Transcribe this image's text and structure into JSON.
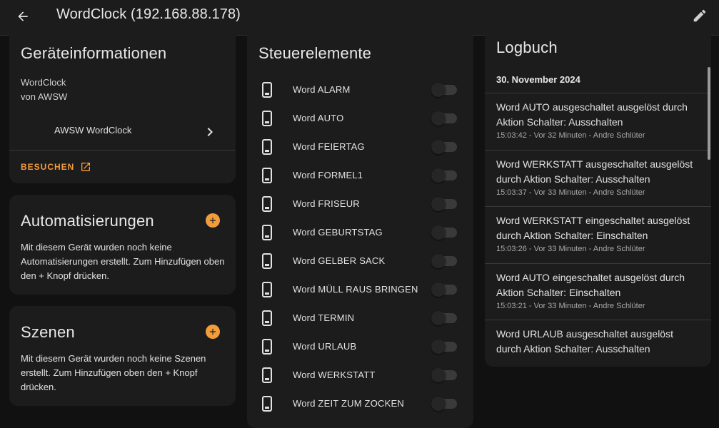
{
  "header": {
    "title": "WordClock (192.168.88.178)",
    "back_icon": "arrow-left-icon",
    "edit_icon": "pencil-icon"
  },
  "colors": {
    "accent": "#f39c3c",
    "card_bg": "#1c1c1c",
    "page_bg": "#111111"
  },
  "device_info": {
    "title": "Geräteinformationen",
    "model": "WordClock",
    "vendor": "von AWSW",
    "entry_label": "AWSW WordClock",
    "visit_label": "BESUCHEN"
  },
  "automations": {
    "title": "Automatisierungen",
    "text": "Mit diesem Gerät wurden noch keine Automatisierungen erstellt. Zum Hinzufügen oben den + Knopf drücken."
  },
  "scenes": {
    "title": "Szenen",
    "text": "Mit diesem Gerät wurden noch keine Szenen erstellt. Zum Hinzufügen oben den + Knopf drücken."
  },
  "controls": {
    "title": "Steuerelemente",
    "items": [
      {
        "label": "Word ALARM",
        "state": "off"
      },
      {
        "label": "Word AUTO",
        "state": "off"
      },
      {
        "label": "Word FEIERTAG",
        "state": "off"
      },
      {
        "label": "Word FORMEL1",
        "state": "off"
      },
      {
        "label": "Word FRISEUR",
        "state": "off"
      },
      {
        "label": "Word GEBURTSTAG",
        "state": "off"
      },
      {
        "label": "Word GELBER SACK",
        "state": "off"
      },
      {
        "label": "Word MÜLL RAUS BRINGEN",
        "state": "off"
      },
      {
        "label": "Word TERMIN",
        "state": "off"
      },
      {
        "label": "Word URLAUB",
        "state": "off"
      },
      {
        "label": "Word WERKSTATT",
        "state": "off"
      },
      {
        "label": "Word ZEIT ZUM ZOCKEN",
        "state": "off"
      }
    ]
  },
  "logbook": {
    "title": "Logbuch",
    "date": "30. November 2024",
    "entries": [
      {
        "message": "Word AUTO ausgeschaltet ausgelöst durch Aktion Schalter: Ausschalten",
        "meta": "15:03:42 - Vor 32 Minuten - Andre Schlüter"
      },
      {
        "message": "Word WERKSTATT ausgeschaltet ausgelöst durch Aktion Schalter: Ausschalten",
        "meta": "15:03:37 - Vor 33 Minuten - Andre Schlüter"
      },
      {
        "message": "Word WERKSTATT eingeschaltet ausgelöst durch Aktion Schalter: Einschalten",
        "meta": "15:03:26 - Vor 33 Minuten - Andre Schlüter"
      },
      {
        "message": "Word AUTO eingeschaltet ausgelöst durch Aktion Schalter: Einschalten",
        "meta": "15:03:21 - Vor 33 Minuten - Andre Schlüter"
      },
      {
        "message": "Word URLAUB ausgeschaltet ausgelöst durch Aktion Schalter: Ausschalten",
        "meta": ""
      }
    ]
  }
}
